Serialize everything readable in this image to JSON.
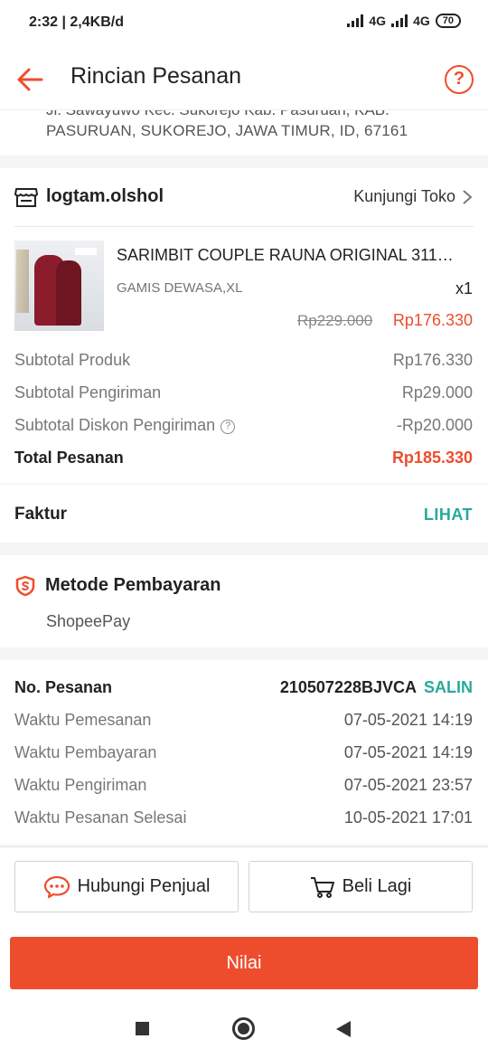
{
  "status": {
    "time": "2:32",
    "speed": "2,4KB/d",
    "net1": "4G",
    "net2": "4G",
    "battery": "70"
  },
  "appbar": {
    "title": "Rincian Pesanan",
    "help": "?"
  },
  "address": {
    "cut_line": "Jl. Sawayuwo Kec. Sukorejo Kab. Pasuruan, KAB.",
    "line": "PASURUAN, SUKOREJO, JAWA TIMUR, ID, 67161"
  },
  "shop": {
    "name": "logtam.olshol",
    "visit_label": "Kunjungi Toko"
  },
  "product": {
    "title": "SARIMBIT COUPLE RAUNA ORIGINAL 311…",
    "variant": "GAMIS DEWASA,XL",
    "qty": "x1",
    "price_old": "Rp229.000",
    "price_new": "Rp176.330"
  },
  "summary": [
    {
      "label": "Subtotal Produk",
      "value": "Rp176.330"
    },
    {
      "label": "Subtotal Pengiriman",
      "value": "Rp29.000"
    },
    {
      "label": "Subtotal Diskon Pengiriman",
      "value": "-Rp20.000"
    },
    {
      "label": "Total Pesanan",
      "value": "Rp185.330"
    }
  ],
  "invoice": {
    "label": "Faktur",
    "action": "LIHAT"
  },
  "payment": {
    "title": "Metode Pembayaran",
    "method": "ShopeePay"
  },
  "order": {
    "number_label": "No. Pesanan",
    "number": "210507228BJVCA",
    "copy": "SALIN",
    "times": [
      {
        "label": "Waktu Pemesanan",
        "value": "07-05-2021 14:19"
      },
      {
        "label": "Waktu Pembayaran",
        "value": "07-05-2021 14:19"
      },
      {
        "label": "Waktu Pengiriman",
        "value": "07-05-2021 23:57"
      },
      {
        "label": "Waktu Pesanan Selesai",
        "value": "10-05-2021 17:01"
      }
    ]
  },
  "actions": {
    "chat": "Hubungi Penjual",
    "buy_again": "Beli Lagi",
    "rate": "Nilai"
  },
  "colors": {
    "accent": "#ee4d2d",
    "teal": "#26aa99"
  }
}
